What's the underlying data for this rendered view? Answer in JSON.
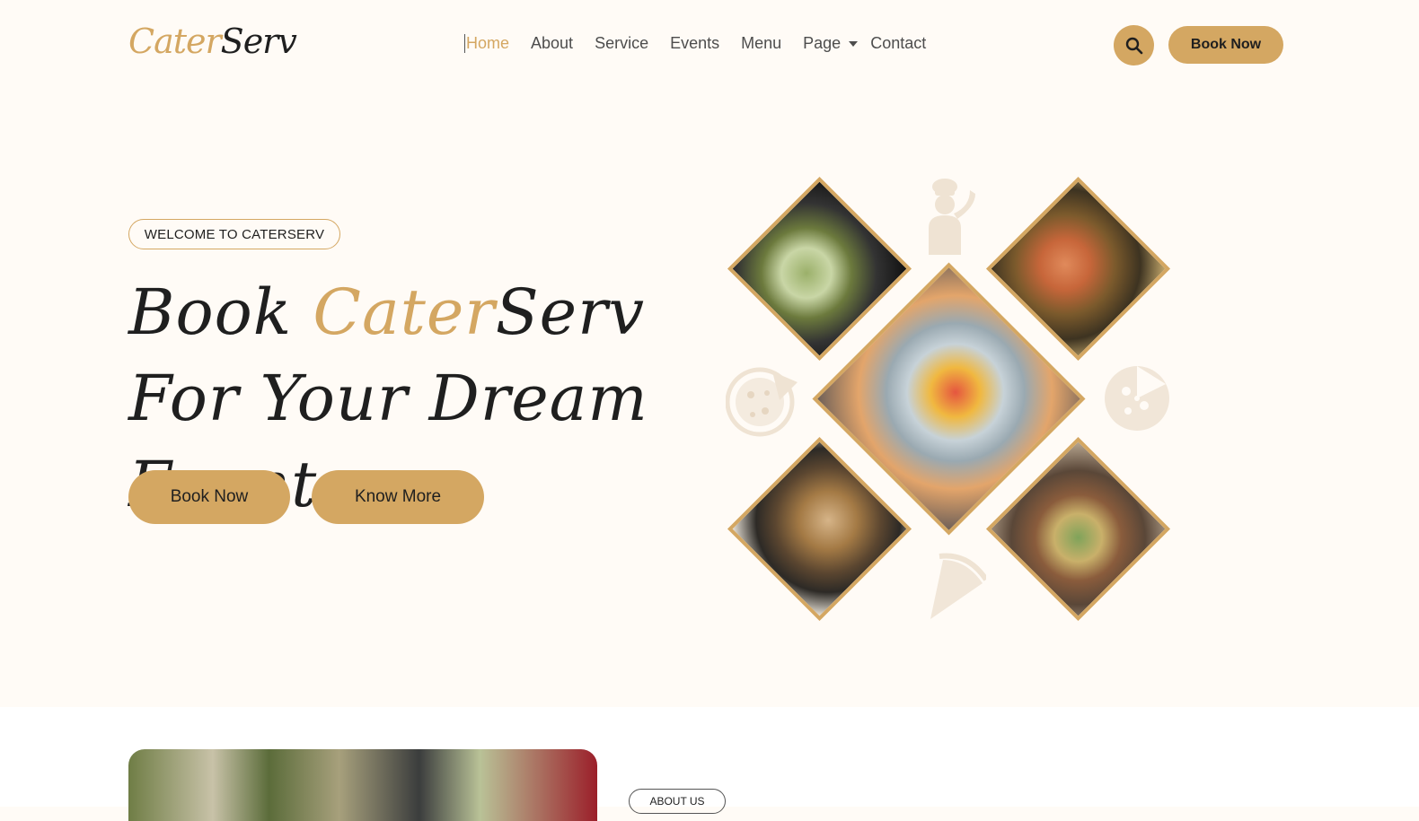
{
  "brand": {
    "part1": "Cater",
    "part2": "Serv"
  },
  "nav": {
    "items": [
      "Home",
      "About",
      "Service",
      "Events",
      "Menu",
      "Page",
      "Contact"
    ],
    "active": "Home",
    "book_label": "Book Now",
    "search_icon": "search-icon"
  },
  "hero": {
    "badge": "WELCOME TO CATERSERV",
    "title_part1": "Book ",
    "title_gold": "Cater",
    "title_part2": "Serv For Your Dream Event",
    "buttons": [
      "Book Now",
      "Know More"
    ]
  },
  "about": {
    "badge": "ABOUT US"
  },
  "colors": {
    "accent": "#d4a762",
    "background": "#fffbf6",
    "text": "#1f1f1f"
  }
}
